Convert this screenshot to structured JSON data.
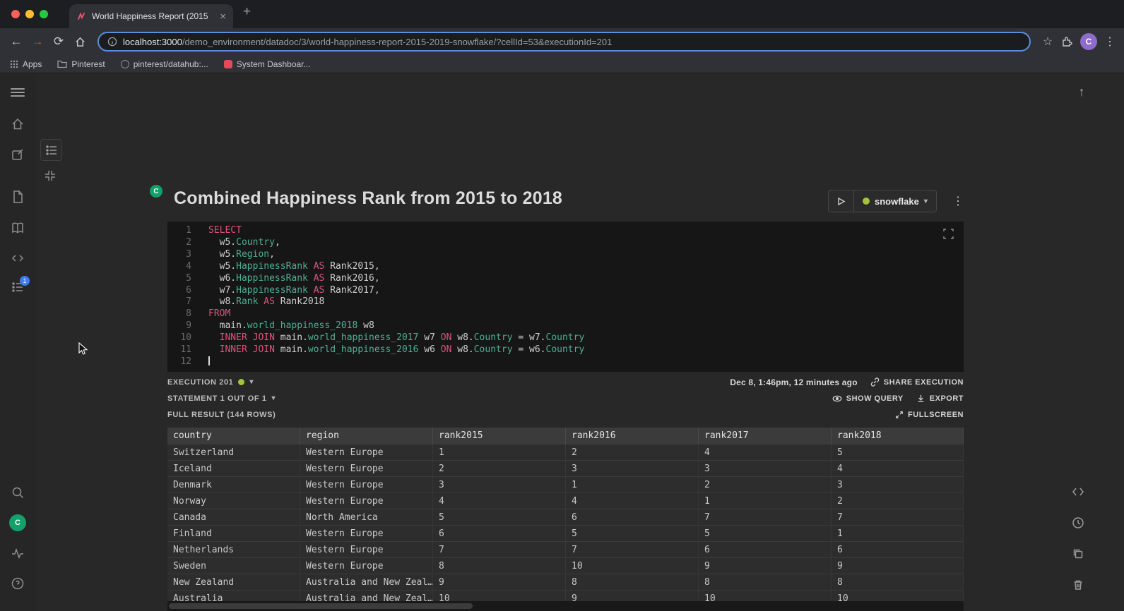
{
  "browser": {
    "tab_title": "World Happiness Report (2015",
    "url_host": "localhost:3000",
    "url_path": "/demo_environment/datadoc/3/world-happiness-report-2015-2019-snowflake/?cellId=53&executionId=201",
    "avatar_letter": "C",
    "bookmarks": [
      "Apps",
      "Pinterest",
      "pinterest/datahub:...",
      "System Dashboar..."
    ]
  },
  "icons": {
    "close_tab": "×",
    "new_tab": "+",
    "back": "←",
    "forward": "→",
    "reload": "⟳",
    "star": "☆",
    "kebab": "⋮",
    "caret_down": "▾",
    "scroll_top": "↑",
    "help": "?"
  },
  "sidebar": {
    "notification_count": "1",
    "avatar_letter": "C"
  },
  "cell": {
    "avatar_letter": "C",
    "title": "Combined Happiness Rank from 2015 to 2018",
    "engine_label": "snowflake"
  },
  "editor": {
    "lines": [
      [
        {
          "t": "k",
          "v": "SELECT"
        }
      ],
      [
        {
          "t": "p",
          "v": "  w5."
        },
        {
          "t": "i",
          "v": "Country"
        },
        {
          "t": "p",
          "v": ","
        }
      ],
      [
        {
          "t": "p",
          "v": "  w5."
        },
        {
          "t": "i",
          "v": "Region"
        },
        {
          "t": "p",
          "v": ","
        }
      ],
      [
        {
          "t": "p",
          "v": "  w5."
        },
        {
          "t": "i",
          "v": "HappinessRank"
        },
        {
          "t": "p",
          "v": " "
        },
        {
          "t": "k",
          "v": "AS"
        },
        {
          "t": "p",
          "v": " Rank2015,"
        }
      ],
      [
        {
          "t": "p",
          "v": "  w6."
        },
        {
          "t": "i",
          "v": "HappinessRank"
        },
        {
          "t": "p",
          "v": " "
        },
        {
          "t": "k",
          "v": "AS"
        },
        {
          "t": "p",
          "v": " Rank2016,"
        }
      ],
      [
        {
          "t": "p",
          "v": "  w7."
        },
        {
          "t": "i",
          "v": "HappinessRank"
        },
        {
          "t": "p",
          "v": " "
        },
        {
          "t": "k",
          "v": "AS"
        },
        {
          "t": "p",
          "v": " Rank2017,"
        }
      ],
      [
        {
          "t": "p",
          "v": "  w8."
        },
        {
          "t": "i",
          "v": "Rank"
        },
        {
          "t": "p",
          "v": " "
        },
        {
          "t": "k",
          "v": "AS"
        },
        {
          "t": "p",
          "v": " Rank2018"
        }
      ],
      [
        {
          "t": "k",
          "v": "FROM"
        }
      ],
      [
        {
          "t": "p",
          "v": "  main."
        },
        {
          "t": "i",
          "v": "world_happiness_2018"
        },
        {
          "t": "p",
          "v": " w8"
        }
      ],
      [
        {
          "t": "p",
          "v": "  "
        },
        {
          "t": "k",
          "v": "INNER JOIN"
        },
        {
          "t": "p",
          "v": " main."
        },
        {
          "t": "i",
          "v": "world_happiness_2017"
        },
        {
          "t": "p",
          "v": " w7 "
        },
        {
          "t": "k",
          "v": "ON"
        },
        {
          "t": "p",
          "v": " w8."
        },
        {
          "t": "i",
          "v": "Country"
        },
        {
          "t": "p",
          "v": " = w7."
        },
        {
          "t": "i",
          "v": "Country"
        }
      ],
      [
        {
          "t": "p",
          "v": "  "
        },
        {
          "t": "k",
          "v": "INNER JOIN"
        },
        {
          "t": "p",
          "v": " main."
        },
        {
          "t": "i",
          "v": "world_happiness_2016"
        },
        {
          "t": "p",
          "v": " w6 "
        },
        {
          "t": "k",
          "v": "ON"
        },
        {
          "t": "p",
          "v": " w8."
        },
        {
          "t": "i",
          "v": "Country"
        },
        {
          "t": "p",
          "v": " = w6."
        },
        {
          "t": "i",
          "v": "Country"
        }
      ],
      []
    ]
  },
  "execution": {
    "execution_label": "EXECUTION 201",
    "timestamp": "Dec 8, 1:46pm, 12 minutes ago",
    "share_label": "SHARE EXECUTION",
    "statement_label": "STATEMENT 1 OUT OF 1",
    "show_query_label": "SHOW QUERY",
    "export_label": "EXPORT",
    "full_result_label": "FULL RESULT (144 ROWS)",
    "fullscreen_label": "FULLSCREEN"
  },
  "table": {
    "columns": [
      "country",
      "region",
      "rank2015",
      "rank2016",
      "rank2017",
      "rank2018"
    ],
    "rows": [
      [
        "Switzerland",
        "Western Europe",
        "1",
        "2",
        "4",
        "5"
      ],
      [
        "Iceland",
        "Western Europe",
        "2",
        "3",
        "3",
        "4"
      ],
      [
        "Denmark",
        "Western Europe",
        "3",
        "1",
        "2",
        "3"
      ],
      [
        "Norway",
        "Western Europe",
        "4",
        "4",
        "1",
        "2"
      ],
      [
        "Canada",
        "North America",
        "5",
        "6",
        "7",
        "7"
      ],
      [
        "Finland",
        "Western Europe",
        "6",
        "5",
        "5",
        "1"
      ],
      [
        "Netherlands",
        "Western Europe",
        "7",
        "7",
        "6",
        "6"
      ],
      [
        "Sweden",
        "Western Europe",
        "8",
        "10",
        "9",
        "9"
      ],
      [
        "New Zealand",
        "Australia and New Zeal…",
        "9",
        "8",
        "8",
        "8"
      ],
      [
        "Australia",
        "Australia and New Zeal…",
        "10",
        "9",
        "10",
        "10"
      ]
    ]
  }
}
